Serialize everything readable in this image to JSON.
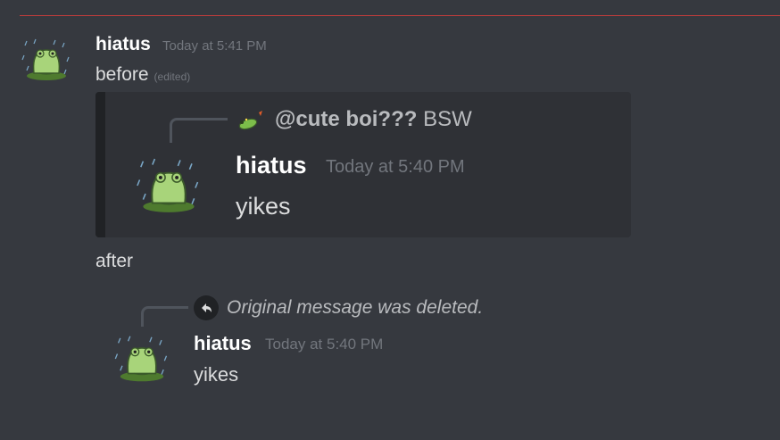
{
  "colors": {
    "background": "#36393f",
    "new_divider": "#c23c3c",
    "embed_bg": "#2f3136",
    "username": "#ffffff",
    "timestamp": "#72767d",
    "text": "#dcddde"
  },
  "message": {
    "author": "hiatus",
    "timestamp": "Today at 5:41 PM",
    "before_text": "before",
    "edited_label": "(edited)",
    "after_text": "after"
  },
  "before_embed": {
    "reply": {
      "icon": "frog-emoji-icon",
      "mention": "@cute boi???",
      "preview": "BSW"
    },
    "author": "hiatus",
    "timestamp": "Today at 5:40 PM",
    "content": "yikes"
  },
  "after_embed": {
    "reply": {
      "icon": "reply-arrow-icon",
      "deleted_text": "Original message was deleted."
    },
    "author": "hiatus",
    "timestamp": "Today at 5:40 PM",
    "content": "yikes"
  }
}
